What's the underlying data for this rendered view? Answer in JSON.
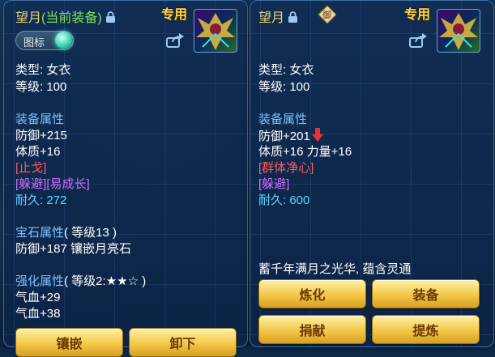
{
  "left": {
    "name": "望月",
    "current_tag": "(当前装备)",
    "special": "专用",
    "icon_toggle": "图标",
    "type_line": "类型: 女衣",
    "level_line": "等级: 100",
    "attr_title": "装备属性",
    "defense": "防御+215",
    "physique": "体质+16",
    "effect_red": "[止戈]",
    "effect_purple": "[躲避][易成长]",
    "dur_label": "耐久: ",
    "dur_value": "272",
    "gem_title": "宝石属性",
    "gem_level": "( 等级13 )",
    "gem_line": "防御+187 镶嵌月亮石",
    "enh_title": "强化属性",
    "enh_level": "( 等级2:★★☆ )",
    "hp1": "气血+29",
    "hp2": "气血+38",
    "btn_inlay": "镶嵌",
    "btn_unequip": "卸下"
  },
  "right": {
    "name": "望月",
    "seal": "御",
    "special": "专用",
    "type_line": "类型: 女衣",
    "level_line": "等级: 100",
    "attr_title": "装备属性",
    "defense": "防御+201",
    "stats": "体质+16 力量+16",
    "effect_red": "[群体净心]",
    "effect_purple": "[躲避]",
    "dur_label": "耐久: ",
    "dur_value": "600",
    "motto": "蓄千年满月之光华, 蕴含灵通",
    "btn_refine": "炼化",
    "btn_equip": "装备",
    "btn_donate": "捐献",
    "btn_extract": "提炼"
  },
  "colors": {
    "section": "#7ec0ff",
    "red": "#ff5a5a",
    "purple": "#d26bff",
    "durability": "#5fd6ff",
    "button": "#f3c74a"
  }
}
